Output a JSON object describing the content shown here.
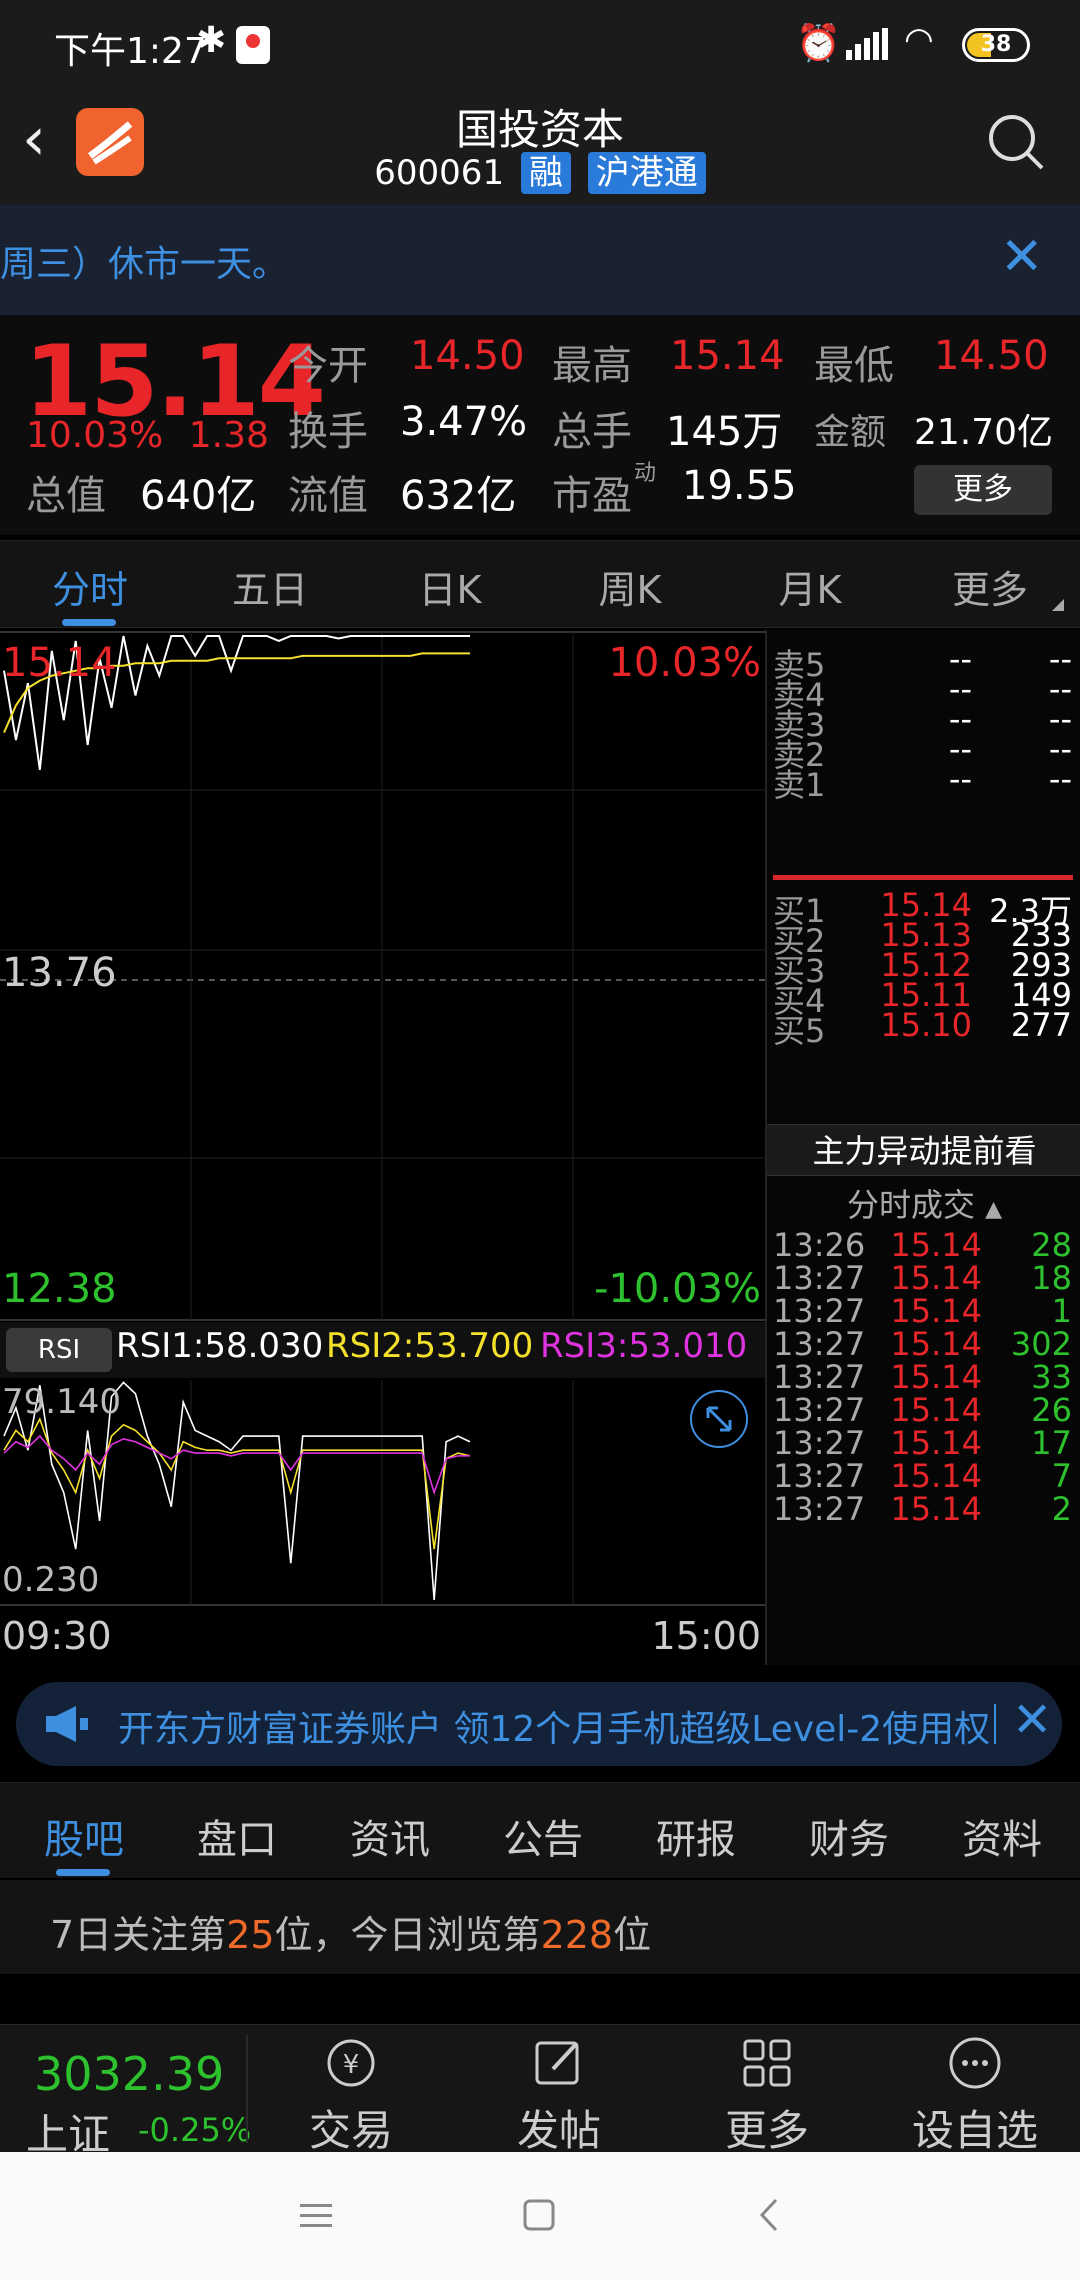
{
  "status_bar": {
    "time": "下午1:27",
    "battery": "38"
  },
  "header": {
    "title": "国投资本",
    "code": "600061",
    "tag1": "融",
    "tag2": "沪港通"
  },
  "notice": {
    "text": "周三）休市一天。"
  },
  "quote": {
    "price": "15.14",
    "change_pct": "10.03%",
    "change": "1.38",
    "fields": [
      {
        "label": "今开",
        "value": "14.50",
        "color": "red"
      },
      {
        "label": "最高",
        "value": "15.14",
        "color": "red"
      },
      {
        "label": "最低",
        "value": "14.50",
        "color": "red"
      },
      {
        "label": "换手",
        "value": "3.47%",
        "color": "white"
      },
      {
        "label": "总手",
        "value": "145万",
        "color": "white"
      },
      {
        "label": "金额",
        "value": "21.70亿",
        "color": "white"
      },
      {
        "label": "总值",
        "value": "640亿",
        "color": "white"
      },
      {
        "label": "流值",
        "value": "632亿",
        "color": "white"
      },
      {
        "label": "市盈",
        "value": "19.55",
        "color": "white",
        "sup": "动"
      }
    ],
    "more_label": "更多"
  },
  "period_tabs": [
    "分时",
    "五日",
    "日K",
    "周K",
    "月K",
    "更多"
  ],
  "chart": {
    "top_price": "15.14",
    "top_pct": "10.03%",
    "mid_price": "13.76",
    "bottom_price": "12.38",
    "bottom_pct": "-10.03%",
    "start_time": "09:30",
    "end_time": "15:00",
    "rsi_label": "RSI",
    "rsi1": "RSI1:58.030",
    "rsi2": "RSI2:53.700",
    "rsi3": "RSI3:53.010",
    "rsi_top": "79.140",
    "rsi_bottom": "0.230",
    "colors": {
      "price": "#ffffff",
      "avg": "#f5e12c",
      "rsi1": "#ffffff",
      "rsi2": "#f5e12c",
      "rsi3": "#e033e0"
    }
  },
  "order_book": {
    "sell": [
      {
        "label": "卖5",
        "price": "--",
        "vol": "--"
      },
      {
        "label": "卖4",
        "price": "--",
        "vol": "--"
      },
      {
        "label": "卖3",
        "price": "--",
        "vol": "--"
      },
      {
        "label": "卖2",
        "price": "--",
        "vol": "--"
      },
      {
        "label": "卖1",
        "price": "--",
        "vol": "--"
      }
    ],
    "buy": [
      {
        "label": "买1",
        "price": "15.14",
        "vol": "2.3万"
      },
      {
        "label": "买2",
        "price": "15.13",
        "vol": "233"
      },
      {
        "label": "买3",
        "price": "15.12",
        "vol": "293"
      },
      {
        "label": "买4",
        "price": "15.11",
        "vol": "149"
      },
      {
        "label": "买5",
        "price": "15.10",
        "vol": "277"
      }
    ],
    "hint": "主力异动提前看",
    "ticks_header": "分时成交",
    "ticks": [
      {
        "time": "13:26",
        "price": "15.14",
        "vol": "28",
        "dir": "up"
      },
      {
        "time": "13:27",
        "price": "15.14",
        "vol": "18",
        "dir": "up"
      },
      {
        "time": "13:27",
        "price": "15.14",
        "vol": "1",
        "dir": "up"
      },
      {
        "time": "13:27",
        "price": "15.14",
        "vol": "302",
        "dir": "up"
      },
      {
        "time": "13:27",
        "price": "15.14",
        "vol": "33",
        "dir": "up"
      },
      {
        "time": "13:27",
        "price": "15.14",
        "vol": "26",
        "dir": "up"
      },
      {
        "time": "13:27",
        "price": "15.14",
        "vol": "17",
        "dir": "up"
      },
      {
        "time": "13:27",
        "price": "15.14",
        "vol": "7",
        "dir": "up"
      },
      {
        "time": "13:27",
        "price": "15.14",
        "vol": "2",
        "dir": "up"
      }
    ]
  },
  "promo": {
    "text": "开东方财富证券账户 领12个月手机超级Level-2使用权"
  },
  "bottom_tabs": [
    "股吧",
    "盘口",
    "资讯",
    "公告",
    "研报",
    "财务",
    "资料"
  ],
  "rank": {
    "p1": "7日关注第",
    "n1": "25",
    "p2": "位，今日浏览第",
    "n2": "228",
    "p3": "位"
  },
  "index": {
    "value": "3032.39",
    "name": "上证",
    "change": "-0.25%"
  },
  "nav": [
    {
      "label": "交易",
      "icon": "trade-icon"
    },
    {
      "label": "发帖",
      "icon": "post-icon"
    },
    {
      "label": "更多",
      "icon": "grid-icon"
    },
    {
      "label": "设自选",
      "icon": "add-watch-icon"
    }
  ]
}
